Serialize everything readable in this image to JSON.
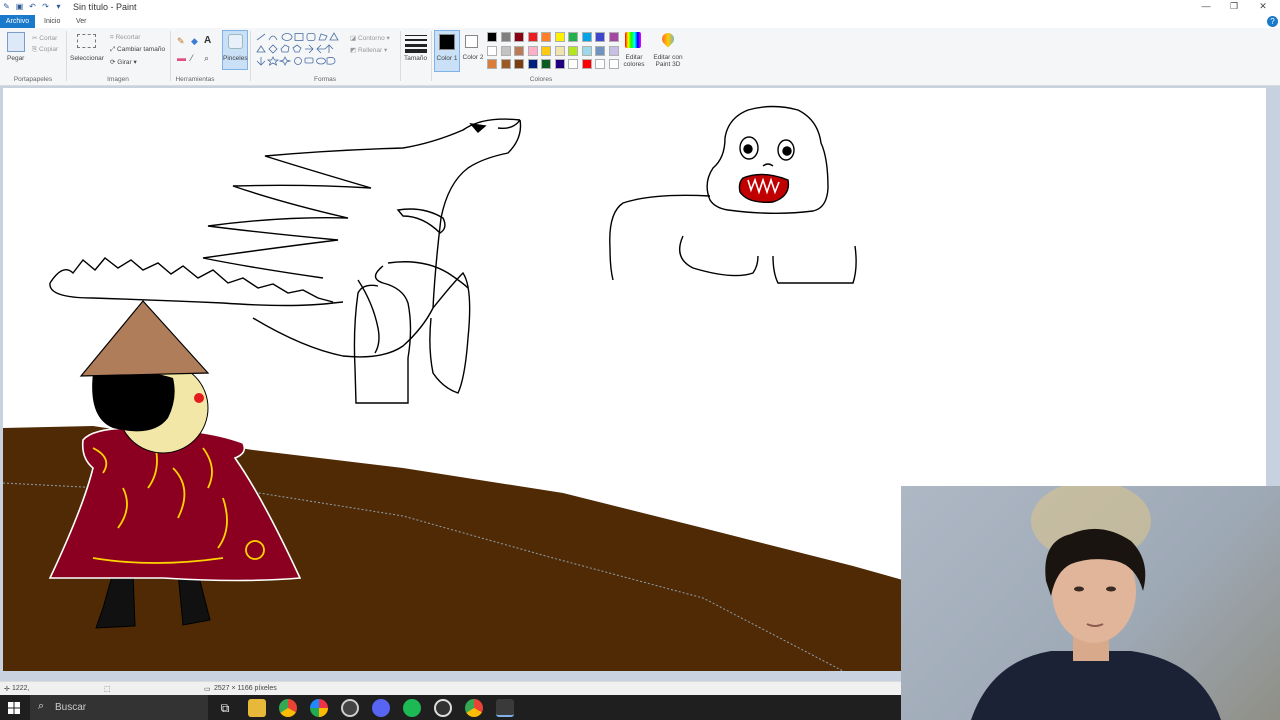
{
  "window": {
    "title": "Sin título - Paint",
    "controls": [
      "—",
      "❐",
      "✕"
    ]
  },
  "tabs": {
    "file": "Archivo",
    "home": "Inicio",
    "view": "Ver"
  },
  "ribbon": {
    "clipboard": {
      "paste": "Pegar",
      "cut": "Cortar",
      "copy": "Copiar",
      "label": "Portapapeles"
    },
    "image": {
      "select": "Seleccionar",
      "crop": "Recortar",
      "resize": "Cambiar tamaño",
      "rotate": "Girar",
      "label": "Imagen"
    },
    "tools": {
      "label": "Herramientas",
      "brushes": "Pinceles"
    },
    "shapes": {
      "outline": "Contorno",
      "fill": "Rellenar",
      "label": "Formas"
    },
    "size": "Tamaño",
    "colors": {
      "color1": "Color 1",
      "color2": "Color 2",
      "edit_colors": "Editar colores",
      "paint3d": "Editar con Paint 3D",
      "label": "Colores",
      "color1_value": "#000000",
      "color2_value": "#ffffff",
      "palette": [
        "#000000",
        "#7f7f7f",
        "#880015",
        "#ed1c24",
        "#ff7f27",
        "#fff200",
        "#22b14c",
        "#00a2e8",
        "#3f48cc",
        "#a349a4",
        "#ffffff",
        "#c3c3c3",
        "#b97a57",
        "#ffaec9",
        "#ffc90e",
        "#efe4b0",
        "#b5e61d",
        "#99d9ea",
        "#7092be",
        "#c8bfe7",
        "#d97c3c",
        "#9c5a24",
        "#7a3e10",
        "#002080",
        "#0a5c20",
        "#200080",
        "#ffffff",
        "#ff0000",
        "#ffffff",
        "#ffffff"
      ]
    }
  },
  "status": {
    "cursor": "1222,",
    "dimensions": "2527 × 1166 píxeles"
  },
  "taskbar": {
    "search": "Buscar"
  }
}
